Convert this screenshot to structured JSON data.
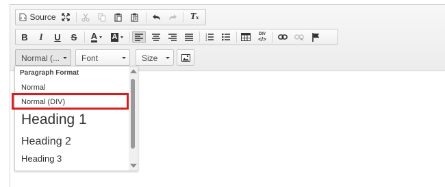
{
  "toolbar": {
    "source_label": "Source",
    "italic_label": "I",
    "bold_label": "B",
    "underline_label": "U",
    "strike_label": "S",
    "text_color_label": "A",
    "bg_color_label": "A",
    "div_label": "DIV",
    "clear_format_label": "Tx"
  },
  "combos": {
    "format": {
      "label": "Normal (...",
      "open": true
    },
    "font": {
      "label": "Font"
    },
    "size": {
      "label": "Size"
    }
  },
  "dropdown": {
    "title": "Paragraph Format",
    "items": [
      "Normal",
      "Normal (DIV)",
      "Heading 1",
      "Heading 2",
      "Heading 3"
    ],
    "highlighted": "Normal (DIV)"
  },
  "colors": {
    "highlight": "#d41f1f",
    "toolbar_bg": "#f2f2f2"
  },
  "icons": [
    "source-icon",
    "maximize-icon",
    "cut-icon",
    "copy-icon",
    "paste-icon",
    "paste-text-icon",
    "undo-icon",
    "redo-icon",
    "remove-format-icon",
    "align-left-icon",
    "align-center-icon",
    "align-right-icon",
    "justify-icon",
    "numbered-list-icon",
    "bulleted-list-icon",
    "table-icon",
    "div-container-icon",
    "link-icon",
    "unlink-icon",
    "anchor-flag-icon",
    "image-icon"
  ]
}
